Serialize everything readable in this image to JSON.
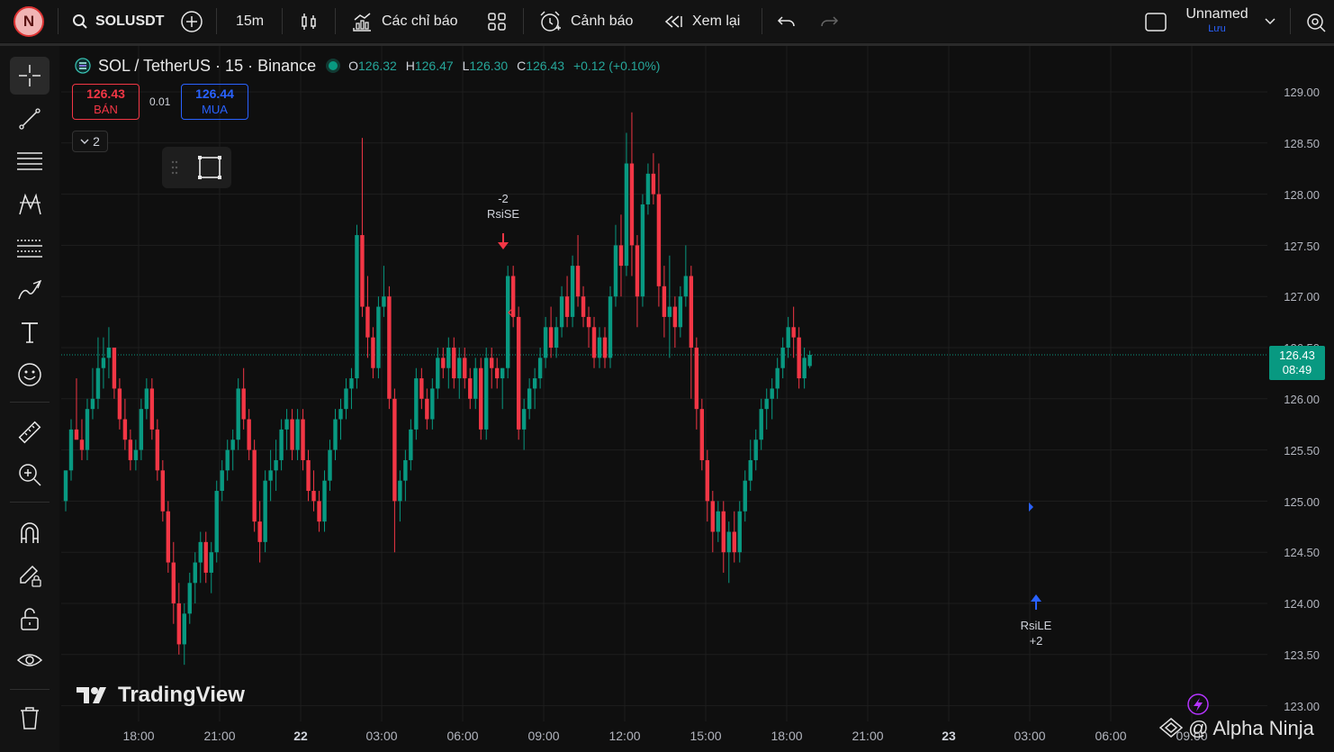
{
  "topbar": {
    "avatar_letter": "N",
    "symbol": "SOLUSDT",
    "interval": "15m",
    "indicators_label": "Các chỉ báo",
    "alerts_label": "Cảnh báo",
    "replay_label": "Xem lại",
    "layout_name": "Unnamed",
    "save_label": "Lưu"
  },
  "legend": {
    "title": "SOL / TetherUS · 15 · Binance",
    "o_key": "O",
    "o_val": "126.32",
    "h_key": "H",
    "h_val": "126.47",
    "l_key": "L",
    "l_val": "126.30",
    "c_key": "C",
    "c_val": "126.43",
    "change": "+0.12 (+0.10%)"
  },
  "trade": {
    "sell_price": "126.43",
    "sell_label": "BÁN",
    "spread": "0.01",
    "buy_price": "126.44",
    "buy_label": "MUA",
    "collapse_count": "2"
  },
  "price_axis": [
    "129.00",
    "128.50",
    "128.00",
    "127.50",
    "127.00",
    "126.50",
    "126.00",
    "125.50",
    "125.00",
    "124.50",
    "124.00",
    "123.50",
    "123.00"
  ],
  "time_axis": [
    "18:00",
    "21:00",
    "22",
    "03:00",
    "06:00",
    "09:00",
    "12:00",
    "15:00",
    "18:00",
    "21:00",
    "23",
    "03:00",
    "06:00",
    "09:00"
  ],
  "current_price": {
    "price": "126.43",
    "countdown": "08:49"
  },
  "signals": {
    "short_qty": "-2",
    "short_name": "RsiSE",
    "long_name": "RsiLE",
    "long_qty": "+2"
  },
  "watermark": "TradingView",
  "overlay_text": "@ Alpha Ninja",
  "colors": {
    "up": "#089981",
    "down": "#f23645",
    "accent": "#2962ff",
    "background": "#0f0f0f"
  },
  "chart_data": {
    "type": "candlestick",
    "title": "SOL / TetherUS · 15 · Binance",
    "ylim": [
      123.0,
      129.0
    ],
    "x_ticks": [
      "18:00",
      "21:00",
      "22",
      "03:00",
      "06:00",
      "09:00",
      "12:00",
      "15:00",
      "18:00",
      "21:00",
      "23",
      "03:00",
      "06:00",
      "09:00"
    ],
    "ohlc": [
      [
        125.0,
        125.3,
        124.9,
        125.3
      ],
      [
        125.3,
        125.8,
        125.2,
        125.7
      ],
      [
        125.7,
        126.2,
        125.6,
        125.6
      ],
      [
        125.6,
        125.8,
        125.4,
        125.5
      ],
      [
        125.5,
        126.0,
        125.4,
        125.9
      ],
      [
        125.9,
        126.3,
        125.8,
        126.0
      ],
      [
        126.0,
        126.6,
        125.9,
        126.3
      ],
      [
        126.3,
        126.6,
        126.1,
        126.4
      ],
      [
        126.4,
        126.7,
        126.2,
        126.5
      ],
      [
        126.5,
        126.5,
        126.0,
        126.1
      ],
      [
        126.1,
        126.2,
        125.7,
        125.8
      ],
      [
        125.8,
        126.0,
        125.5,
        125.6
      ],
      [
        125.6,
        125.7,
        125.3,
        125.4
      ],
      [
        125.4,
        125.6,
        125.3,
        125.5
      ],
      [
        125.5,
        126.0,
        125.4,
        125.9
      ],
      [
        125.9,
        126.2,
        125.8,
        126.1
      ],
      [
        126.1,
        126.2,
        125.6,
        125.7
      ],
      [
        125.7,
        125.8,
        125.2,
        125.3
      ],
      [
        125.3,
        125.4,
        124.8,
        124.9
      ],
      [
        124.9,
        125.0,
        124.3,
        124.4
      ],
      [
        124.4,
        124.6,
        123.8,
        124.0
      ],
      [
        124.0,
        124.2,
        123.5,
        123.6
      ],
      [
        123.6,
        124.0,
        123.4,
        123.9
      ],
      [
        123.9,
        124.3,
        123.8,
        124.2
      ],
      [
        124.2,
        124.5,
        124.0,
        124.4
      ],
      [
        124.4,
        124.7,
        124.2,
        124.6
      ],
      [
        124.6,
        124.7,
        124.2,
        124.3
      ],
      [
        124.3,
        124.6,
        124.1,
        124.5
      ],
      [
        124.5,
        125.2,
        124.4,
        125.1
      ],
      [
        125.1,
        125.4,
        125.0,
        125.3
      ],
      [
        125.3,
        125.6,
        125.2,
        125.5
      ],
      [
        125.5,
        125.7,
        125.3,
        125.6
      ],
      [
        125.6,
        126.2,
        125.5,
        126.1
      ],
      [
        126.1,
        126.3,
        125.7,
        125.8
      ],
      [
        125.8,
        125.9,
        125.4,
        125.5
      ],
      [
        125.5,
        125.6,
        124.7,
        124.8
      ],
      [
        124.8,
        125.0,
        124.4,
        124.6
      ],
      [
        124.6,
        125.3,
        124.5,
        125.2
      ],
      [
        125.2,
        125.5,
        125.0,
        125.3
      ],
      [
        125.3,
        125.6,
        125.1,
        125.4
      ],
      [
        125.4,
        125.8,
        125.3,
        125.7
      ],
      [
        125.7,
        125.9,
        125.5,
        125.8
      ],
      [
        125.8,
        125.9,
        125.4,
        125.5
      ],
      [
        125.5,
        125.9,
        125.4,
        125.8
      ],
      [
        125.8,
        125.9,
        125.3,
        125.4
      ],
      [
        125.4,
        125.5,
        125.0,
        125.1
      ],
      [
        125.1,
        125.3,
        124.9,
        125.0
      ],
      [
        125.0,
        125.1,
        124.7,
        124.8
      ],
      [
        124.8,
        125.3,
        124.7,
        125.2
      ],
      [
        125.2,
        125.6,
        125.1,
        125.5
      ],
      [
        125.5,
        125.9,
        125.4,
        125.8
      ],
      [
        125.8,
        126.0,
        125.6,
        125.9
      ],
      [
        125.9,
        126.2,
        125.8,
        126.1
      ],
      [
        126.1,
        126.3,
        125.9,
        126.2
      ],
      [
        126.2,
        127.7,
        126.1,
        127.6
      ],
      [
        127.6,
        128.55,
        126.8,
        126.9
      ],
      [
        126.9,
        127.2,
        126.4,
        126.6
      ],
      [
        126.6,
        126.7,
        126.2,
        126.3
      ],
      [
        126.3,
        127.0,
        126.2,
        126.9
      ],
      [
        126.9,
        127.3,
        126.8,
        127.0
      ],
      [
        127.0,
        127.1,
        125.9,
        126.0
      ],
      [
        126.0,
        126.1,
        124.5,
        125.0
      ],
      [
        125.0,
        125.3,
        124.8,
        125.2
      ],
      [
        125.2,
        125.5,
        125.0,
        125.4
      ],
      [
        125.4,
        125.8,
        125.3,
        125.7
      ],
      [
        125.7,
        126.3,
        125.6,
        126.2
      ],
      [
        126.2,
        126.3,
        125.9,
        126.0
      ],
      [
        126.0,
        126.1,
        125.7,
        125.8
      ],
      [
        125.8,
        126.2,
        125.7,
        126.1
      ],
      [
        126.1,
        126.5,
        126.0,
        126.4
      ],
      [
        126.4,
        126.5,
        126.2,
        126.3
      ],
      [
        126.3,
        126.6,
        126.1,
        126.5
      ],
      [
        126.5,
        126.6,
        126.1,
        126.2
      ],
      [
        126.2,
        126.5,
        126.0,
        126.4
      ],
      [
        126.4,
        126.5,
        126.1,
        126.2
      ],
      [
        126.2,
        126.3,
        125.9,
        126.0
      ],
      [
        126.0,
        126.4,
        125.9,
        126.3
      ],
      [
        126.3,
        126.4,
        125.6,
        125.7
      ],
      [
        125.7,
        126.5,
        125.6,
        126.4
      ],
      [
        126.4,
        126.5,
        126.1,
        126.3
      ],
      [
        126.3,
        126.4,
        126.1,
        126.2
      ],
      [
        126.2,
        126.3,
        125.9,
        126.3
      ],
      [
        126.3,
        127.3,
        126.2,
        127.2
      ],
      [
        127.2,
        127.3,
        126.7,
        126.8
      ],
      [
        126.8,
        126.9,
        125.6,
        125.7
      ],
      [
        125.7,
        126.0,
        125.5,
        125.9
      ],
      [
        125.9,
        126.2,
        125.8,
        126.1
      ],
      [
        126.1,
        126.3,
        125.9,
        126.2
      ],
      [
        126.2,
        126.5,
        126.1,
        126.4
      ],
      [
        126.4,
        126.8,
        126.3,
        126.7
      ],
      [
        126.7,
        126.9,
        126.4,
        126.5
      ],
      [
        126.5,
        126.8,
        126.4,
        126.7
      ],
      [
        126.7,
        127.1,
        126.6,
        127.0
      ],
      [
        127.0,
        127.2,
        126.7,
        126.8
      ],
      [
        126.8,
        127.4,
        126.7,
        127.3
      ],
      [
        127.3,
        127.6,
        126.9,
        127.0
      ],
      [
        127.0,
        127.1,
        126.7,
        126.8
      ],
      [
        126.8,
        126.9,
        126.5,
        126.7
      ],
      [
        126.7,
        126.8,
        126.3,
        126.4
      ],
      [
        126.4,
        126.7,
        126.3,
        126.6
      ],
      [
        126.6,
        126.7,
        126.3,
        126.4
      ],
      [
        126.4,
        127.1,
        126.3,
        127.0
      ],
      [
        127.0,
        127.7,
        126.9,
        127.5
      ],
      [
        127.5,
        127.8,
        127.0,
        127.3
      ],
      [
        127.3,
        128.6,
        127.2,
        128.3
      ],
      [
        128.3,
        128.8,
        127.2,
        127.5
      ],
      [
        127.5,
        127.6,
        126.7,
        127.0
      ],
      [
        127.0,
        128.0,
        126.9,
        127.9
      ],
      [
        127.9,
        128.3,
        127.8,
        128.2
      ],
      [
        128.2,
        128.4,
        127.9,
        128.0
      ],
      [
        128.0,
        128.3,
        126.9,
        127.1
      ],
      [
        127.1,
        127.3,
        126.6,
        126.8
      ],
      [
        126.8,
        127.4,
        126.4,
        126.9
      ],
      [
        126.9,
        127.0,
        126.5,
        126.7
      ],
      [
        126.7,
        127.1,
        126.6,
        127.0
      ],
      [
        127.0,
        127.5,
        126.9,
        127.2
      ],
      [
        127.2,
        127.3,
        126.0,
        126.5
      ],
      [
        126.5,
        126.6,
        125.7,
        125.9
      ],
      [
        125.9,
        126.0,
        125.3,
        125.4
      ],
      [
        125.4,
        125.5,
        124.8,
        125.0
      ],
      [
        125.0,
        125.1,
        124.5,
        124.7
      ],
      [
        124.7,
        125.0,
        124.6,
        124.9
      ],
      [
        124.9,
        125.0,
        124.3,
        124.5
      ],
      [
        124.5,
        124.8,
        124.2,
        124.7
      ],
      [
        124.7,
        124.9,
        124.4,
        124.5
      ],
      [
        124.5,
        125.0,
        124.4,
        124.9
      ],
      [
        124.9,
        125.3,
        124.8,
        125.2
      ],
      [
        125.2,
        125.6,
        125.1,
        125.4
      ],
      [
        125.4,
        125.7,
        125.3,
        125.6
      ],
      [
        125.6,
        126.0,
        125.5,
        125.9
      ],
      [
        125.9,
        126.1,
        125.7,
        126.0
      ],
      [
        126.0,
        126.2,
        125.8,
        126.1
      ],
      [
        126.1,
        126.4,
        126.0,
        126.3
      ],
      [
        126.3,
        126.6,
        126.2,
        126.5
      ],
      [
        126.5,
        126.8,
        126.4,
        126.7
      ],
      [
        126.7,
        126.9,
        126.4,
        126.6
      ],
      [
        126.6,
        126.7,
        126.1,
        126.2
      ],
      [
        126.2,
        126.5,
        126.1,
        126.4
      ],
      [
        126.32,
        126.47,
        126.3,
        126.43
      ]
    ]
  }
}
